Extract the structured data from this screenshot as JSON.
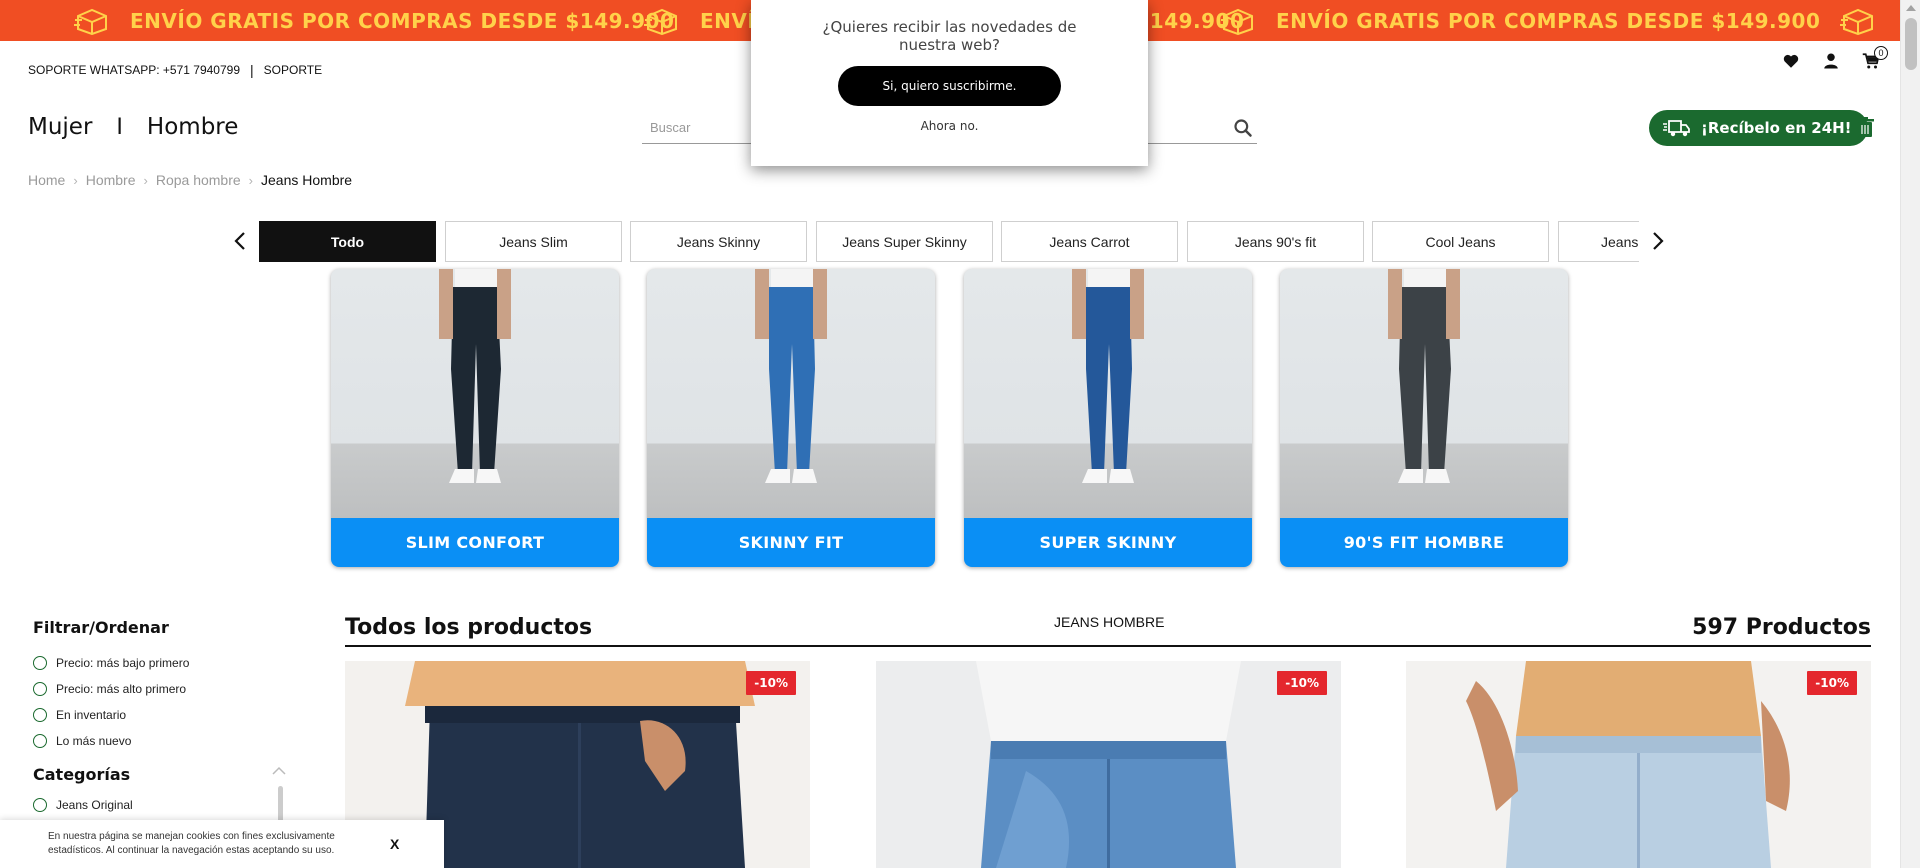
{
  "promo": {
    "text": "ENVÍO GRATIS POR COMPRAS DESDE $149.900",
    "bg_color": "#f04e23",
    "text_color": "#ffd24a"
  },
  "support": {
    "whatsapp": "SOPORTE WHATSAPP: +571 7940799",
    "separator": "|",
    "support_link": "SOPORTE"
  },
  "cart": {
    "count": "0"
  },
  "header": {
    "nav_women": "Mujer",
    "nav_separator": "I",
    "nav_men": "Hombre",
    "search_placeholder": "Buscar",
    "delivery_label": "¡Recíbelo en 24H!",
    "delivery_color": "#1b6a2f"
  },
  "breadcrumb": {
    "items": [
      "Home",
      "Hombre",
      "Ropa hombre"
    ],
    "current": "Jeans Hombre"
  },
  "tabs": [
    "Todo",
    "Jeans Slim",
    "Jeans Skinny",
    "Jeans Super Skinny",
    "Jeans Carrot",
    "Jeans 90's fit",
    "Cool Jeans",
    "Jeans"
  ],
  "category_cards": [
    {
      "label": "SLIM CONFORT",
      "jean_color": "#1d2833"
    },
    {
      "label": "SKINNY FIT",
      "jean_color": "#2f6fb5"
    },
    {
      "label": "SUPER SKINNY",
      "jean_color": "#24589a"
    },
    {
      "label": "90'S FIT HOMBRE",
      "jean_color": "#3c4247"
    }
  ],
  "filters": {
    "title": "Filtrar/Ordenar",
    "options": [
      "Precio: más bajo primero",
      "Precio: más alto primero",
      "En inventario",
      "Lo más nuevo"
    ]
  },
  "categories": {
    "title": "Categorías",
    "items": [
      "Jeans Original"
    ]
  },
  "products": {
    "title": "Todos los productos",
    "subtitle": "JEANS HOMBRE",
    "count": "597 Productos",
    "items": [
      {
        "discount": "-10%"
      },
      {
        "discount": "-10%"
      },
      {
        "discount": "-10%"
      }
    ]
  },
  "cookie": {
    "text": "En nuestra página se manejan cookies con fines exclusivamente estadísticos. Al continuar la navegación estas aceptando su uso.",
    "close": "X"
  },
  "popup": {
    "question": "¿Quieres recibir las novedades de nuestra web?",
    "accept": "Si, quiero suscribirme.",
    "decline": "Ahora no."
  }
}
